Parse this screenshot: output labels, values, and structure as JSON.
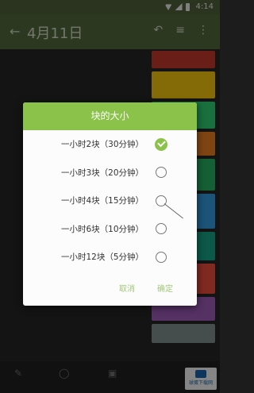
{
  "status_bar": {
    "time": "4:14"
  },
  "toolbar": {
    "title": "4月11日"
  },
  "dialog": {
    "title": "块的大小",
    "options": [
      {
        "label": "一小时2块（30分钟）",
        "checked": true
      },
      {
        "label": "一小时3块（20分钟）",
        "checked": false
      },
      {
        "label": "一小时4块（15分钟）",
        "checked": false
      },
      {
        "label": "一小时6块（10分钟）",
        "checked": false
      },
      {
        "label": "一小时12块（5分钟）",
        "checked": false
      }
    ],
    "cancel_label": "取消",
    "ok_label": "确定"
  },
  "background": {
    "block_colors": [
      "#c0392b",
      "#f1c40f",
      "#2ecc71",
      "#e67e22",
      "#27ae60",
      "#3498db",
      "#16a085",
      "#e74c3c",
      "#9b59b6",
      "#7f8c8d"
    ]
  },
  "badge": {
    "text": "球蛋下载网"
  },
  "colors": {
    "accent": "#8bc34a",
    "toolbar": "#52663d"
  }
}
